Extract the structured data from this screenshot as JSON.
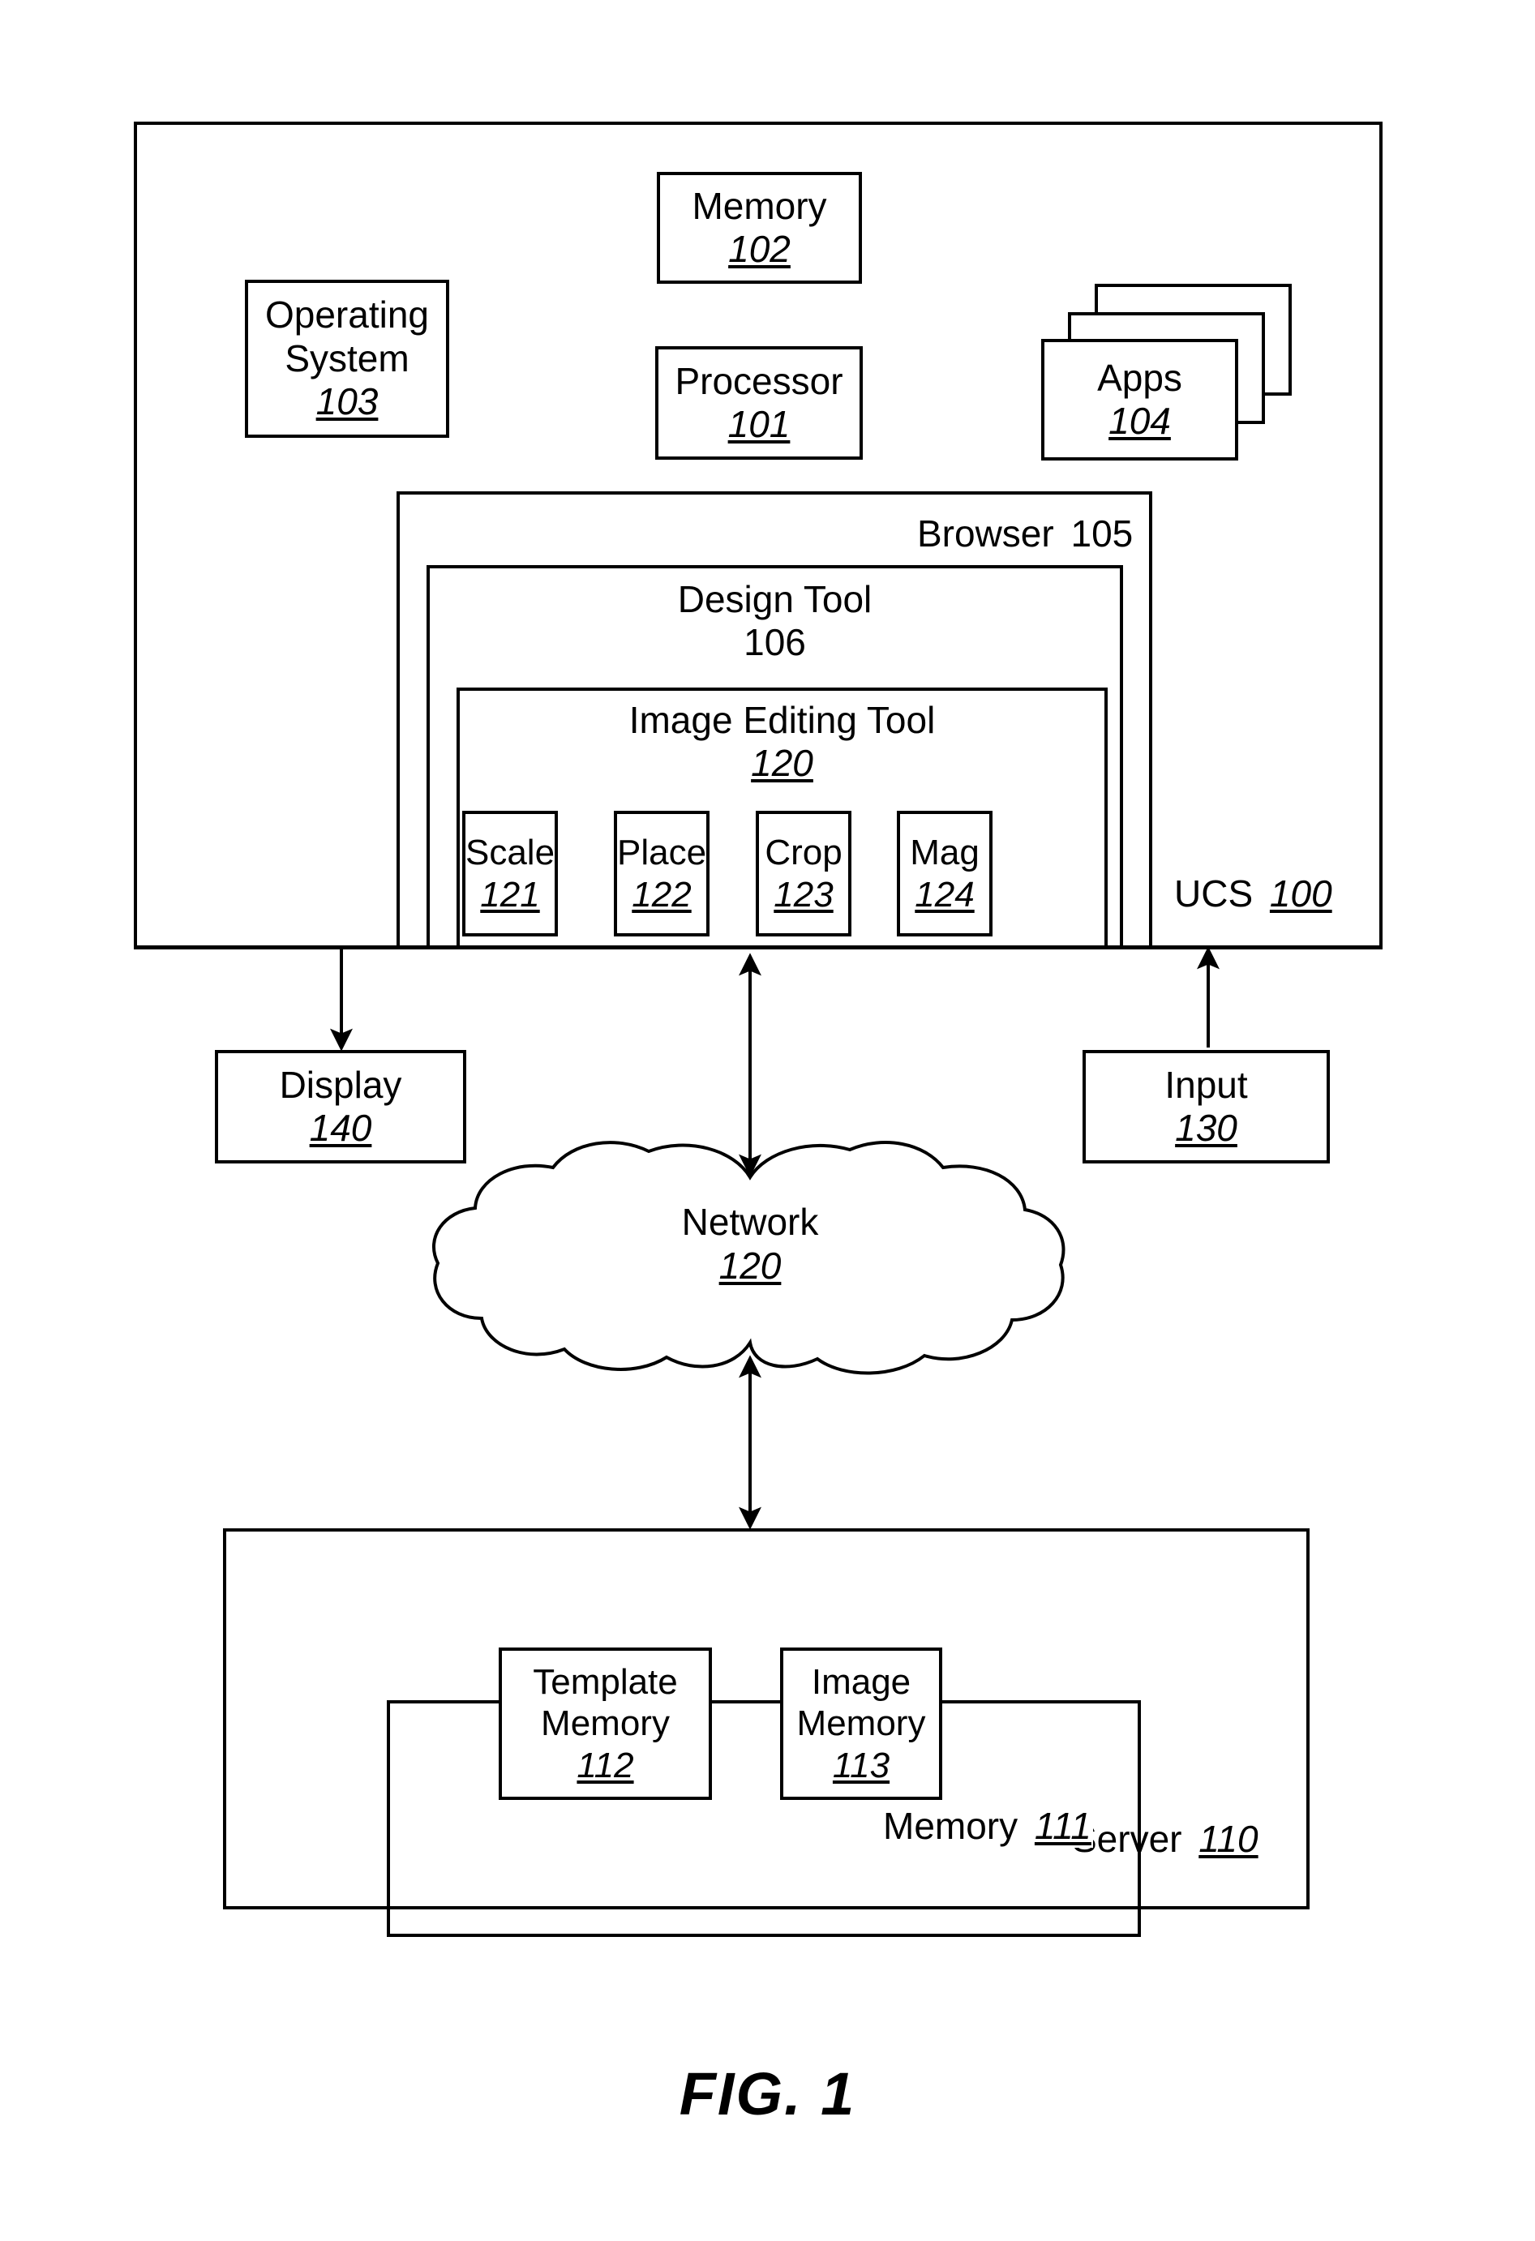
{
  "figure": {
    "caption": "FIG. 1",
    "type": "patent-block-diagram"
  },
  "ucs": {
    "label": "UCS",
    "ref": "100",
    "memory": {
      "label": "Memory",
      "ref": "102"
    },
    "operating_system": {
      "label_line1": "Operating",
      "label_line2": "System",
      "ref": "103"
    },
    "processor": {
      "label": "Processor",
      "ref": "101"
    },
    "apps": {
      "label": "Apps",
      "ref": "104"
    },
    "browser": {
      "label": "Browser",
      "ref": "105"
    },
    "design_tool": {
      "label": "Design Tool",
      "ref": "106"
    },
    "image_editing_tool": {
      "label": "Image Editing Tool",
      "ref": "120"
    },
    "tools": [
      {
        "label": "Scale",
        "ref": "121"
      },
      {
        "label": "Place",
        "ref": "122"
      },
      {
        "label": "Crop",
        "ref": "123"
      },
      {
        "label": "Mag",
        "ref": "124"
      }
    ]
  },
  "peripherals": {
    "display": {
      "label": "Display",
      "ref": "140"
    },
    "input": {
      "label": "Input",
      "ref": "130"
    }
  },
  "network": {
    "label": "Network",
    "ref": "120"
  },
  "server": {
    "label": "Server",
    "ref": "110",
    "memory": {
      "label": "Memory",
      "ref": "111"
    },
    "template_memory": {
      "label_line1": "Template",
      "label_line2": "Memory",
      "ref": "112"
    },
    "image_memory": {
      "label_line1": "Image",
      "label_line2": "Memory",
      "ref": "113"
    }
  },
  "connections": [
    {
      "from": "ucs",
      "to": "display",
      "arrow": "single-down"
    },
    {
      "from": "input",
      "to": "ucs",
      "arrow": "single-up"
    },
    {
      "from": "ucs",
      "to": "network",
      "arrow": "double"
    },
    {
      "from": "network",
      "to": "server",
      "arrow": "double"
    }
  ],
  "colors": {
    "line": "#000000",
    "background": "#ffffff"
  }
}
